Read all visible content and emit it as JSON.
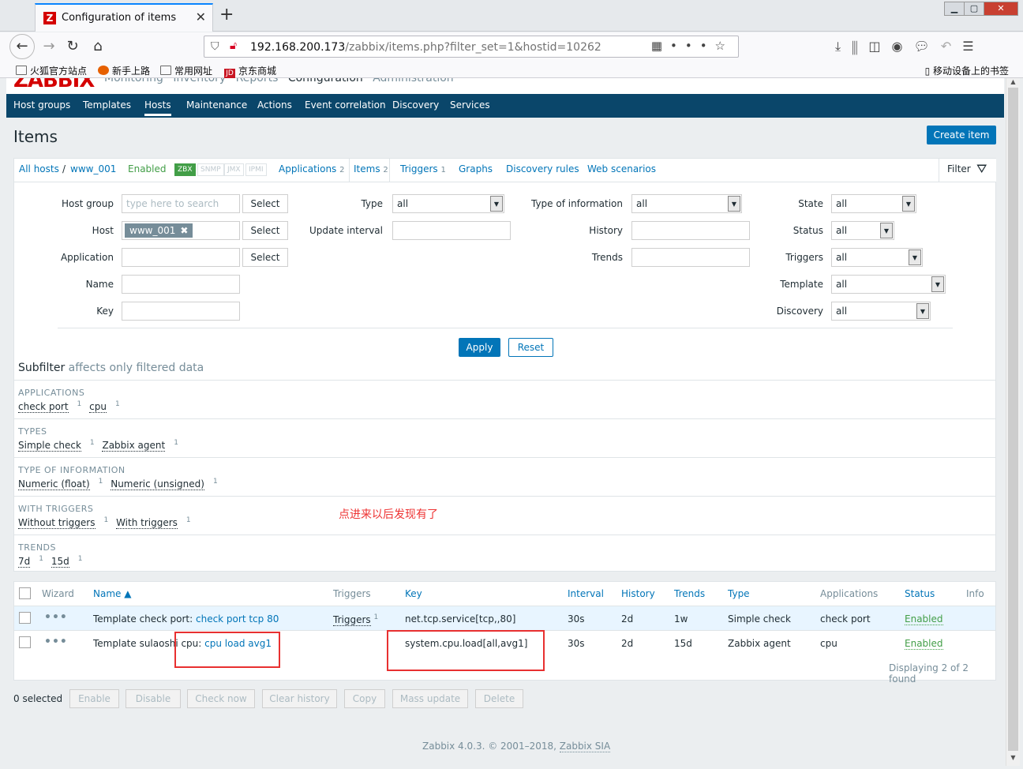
{
  "browser": {
    "tab_title": "Configuration of items",
    "url_host": "192.168.200.173",
    "url_path": "/zabbix/items.php?filter_set=1&hostid=10262",
    "bookmarks": [
      "火狐官方站点",
      "新手上路",
      "常用网址",
      "京东商城"
    ],
    "mobile_bookmarks": "移动设备上的书签"
  },
  "zabbix": {
    "logo": "ZABBIX",
    "top_menu": [
      "Monitoring",
      "Inventory",
      "Reports",
      "Configuration",
      "Administration"
    ],
    "submenu": [
      "Host groups",
      "Templates",
      "Hosts",
      "Maintenance",
      "Actions",
      "Event correlation",
      "Discovery",
      "Services"
    ],
    "page_title": "Items",
    "create_button": "Create item"
  },
  "host_nav": {
    "all_hosts": "All hosts",
    "separator": "/",
    "host": "www_001",
    "status": "Enabled",
    "badges": [
      "ZBX",
      "SNMP",
      "JMX",
      "IPMI"
    ],
    "applications": "Applications",
    "applications_count": "2",
    "items": "Items",
    "items_count": "2",
    "triggers": "Triggers",
    "triggers_count": "1",
    "graphs": "Graphs",
    "discovery_rules": "Discovery rules",
    "web_scenarios": "Web scenarios",
    "filter": "Filter"
  },
  "filter": {
    "host_group_label": "Host group",
    "host_group_placeholder": "type here to search",
    "host_label": "Host",
    "host_value": "www_001",
    "application_label": "Application",
    "name_label": "Name",
    "key_label": "Key",
    "select_label": "Select",
    "type_label": "Type",
    "type_value": "all",
    "update_interval_label": "Update interval",
    "type_of_information_label": "Type of information",
    "type_of_information_value": "all",
    "history_label": "History",
    "trends_label": "Trends",
    "state_label": "State",
    "state_value": "all",
    "status_label": "Status",
    "status_value": "all",
    "triggers_label": "Triggers",
    "triggers_value": "all",
    "template_label": "Template",
    "template_value": "all",
    "discovery_label": "Discovery",
    "discovery_value": "all",
    "apply": "Apply",
    "reset": "Reset"
  },
  "subfilter": {
    "title": "Subfilter",
    "subtitle": "affects only filtered data",
    "groups": [
      {
        "head": "APPLICATIONS",
        "items": [
          {
            "label": "check port",
            "count": "1"
          },
          {
            "label": "cpu",
            "count": "1"
          }
        ]
      },
      {
        "head": "TYPES",
        "items": [
          {
            "label": "Simple check",
            "count": "1"
          },
          {
            "label": "Zabbix agent",
            "count": "1"
          }
        ]
      },
      {
        "head": "TYPE OF INFORMATION",
        "items": [
          {
            "label": "Numeric (float)",
            "count": "1"
          },
          {
            "label": "Numeric (unsigned)",
            "count": "1"
          }
        ]
      },
      {
        "head": "WITH TRIGGERS",
        "items": [
          {
            "label": "Without triggers",
            "count": "1"
          },
          {
            "label": "With triggers",
            "count": "1"
          }
        ]
      },
      {
        "head": "TRENDS",
        "items": [
          {
            "label": "7d",
            "count": "1"
          },
          {
            "label": "15d",
            "count": "1"
          }
        ]
      }
    ]
  },
  "annotation": "点进来以后发现有了",
  "table": {
    "headers": {
      "wizard": "Wizard",
      "name": "Name ▲",
      "triggers": "Triggers",
      "key": "Key",
      "interval": "Interval",
      "history": "History",
      "trends": "Trends",
      "type": "Type",
      "applications": "Applications",
      "status": "Status",
      "info": "Info"
    },
    "rows": [
      {
        "template": "Template check port",
        "name": "check port tcp 80",
        "triggers": "Triggers",
        "triggers_count": "1",
        "key": "net.tcp.service[tcp,,80]",
        "interval": "30s",
        "history": "2d",
        "trends": "1w",
        "type": "Simple check",
        "application": "check port",
        "status": "Enabled"
      },
      {
        "template": "Template sulaoshi cpu",
        "name": "cpu load avg1",
        "triggers": "",
        "triggers_count": "",
        "key": "system.cpu.load[all,avg1]",
        "interval": "30s",
        "history": "2d",
        "trends": "15d",
        "type": "Zabbix agent",
        "application": "cpu",
        "status": "Enabled"
      }
    ],
    "footer": "Displaying 2 of 2 found"
  },
  "actions": {
    "selected": "0 selected",
    "buttons": [
      "Enable",
      "Disable",
      "Check now",
      "Clear history",
      "Copy",
      "Mass update",
      "Delete"
    ]
  },
  "footer": {
    "text": "Zabbix 4.0.3. © 2001–2018, ",
    "company": "Zabbix SIA"
  }
}
